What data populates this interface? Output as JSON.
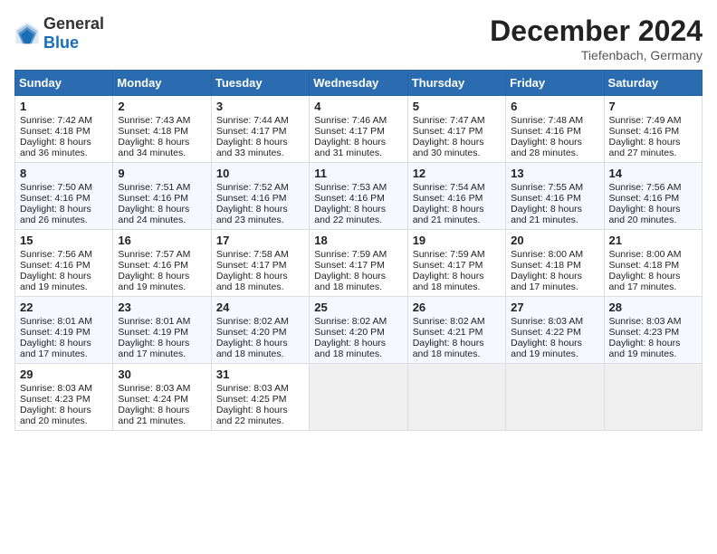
{
  "header": {
    "logo_general": "General",
    "logo_blue": "Blue",
    "month_title": "December 2024",
    "location": "Tiefenbach, Germany"
  },
  "weekdays": [
    "Sunday",
    "Monday",
    "Tuesday",
    "Wednesday",
    "Thursday",
    "Friday",
    "Saturday"
  ],
  "weeks": [
    [
      {
        "day": "1",
        "sunrise": "7:42 AM",
        "sunset": "4:18 PM",
        "daylight": "8 hours and 36 minutes."
      },
      {
        "day": "2",
        "sunrise": "7:43 AM",
        "sunset": "4:18 PM",
        "daylight": "8 hours and 34 minutes."
      },
      {
        "day": "3",
        "sunrise": "7:44 AM",
        "sunset": "4:17 PM",
        "daylight": "8 hours and 33 minutes."
      },
      {
        "day": "4",
        "sunrise": "7:46 AM",
        "sunset": "4:17 PM",
        "daylight": "8 hours and 31 minutes."
      },
      {
        "day": "5",
        "sunrise": "7:47 AM",
        "sunset": "4:17 PM",
        "daylight": "8 hours and 30 minutes."
      },
      {
        "day": "6",
        "sunrise": "7:48 AM",
        "sunset": "4:16 PM",
        "daylight": "8 hours and 28 minutes."
      },
      {
        "day": "7",
        "sunrise": "7:49 AM",
        "sunset": "4:16 PM",
        "daylight": "8 hours and 27 minutes."
      }
    ],
    [
      {
        "day": "8",
        "sunrise": "7:50 AM",
        "sunset": "4:16 PM",
        "daylight": "8 hours and 26 minutes."
      },
      {
        "day": "9",
        "sunrise": "7:51 AM",
        "sunset": "4:16 PM",
        "daylight": "8 hours and 24 minutes."
      },
      {
        "day": "10",
        "sunrise": "7:52 AM",
        "sunset": "4:16 PM",
        "daylight": "8 hours and 23 minutes."
      },
      {
        "day": "11",
        "sunrise": "7:53 AM",
        "sunset": "4:16 PM",
        "daylight": "8 hours and 22 minutes."
      },
      {
        "day": "12",
        "sunrise": "7:54 AM",
        "sunset": "4:16 PM",
        "daylight": "8 hours and 21 minutes."
      },
      {
        "day": "13",
        "sunrise": "7:55 AM",
        "sunset": "4:16 PM",
        "daylight": "8 hours and 21 minutes."
      },
      {
        "day": "14",
        "sunrise": "7:56 AM",
        "sunset": "4:16 PM",
        "daylight": "8 hours and 20 minutes."
      }
    ],
    [
      {
        "day": "15",
        "sunrise": "7:56 AM",
        "sunset": "4:16 PM",
        "daylight": "8 hours and 19 minutes."
      },
      {
        "day": "16",
        "sunrise": "7:57 AM",
        "sunset": "4:16 PM",
        "daylight": "8 hours and 19 minutes."
      },
      {
        "day": "17",
        "sunrise": "7:58 AM",
        "sunset": "4:17 PM",
        "daylight": "8 hours and 18 minutes."
      },
      {
        "day": "18",
        "sunrise": "7:59 AM",
        "sunset": "4:17 PM",
        "daylight": "8 hours and 18 minutes."
      },
      {
        "day": "19",
        "sunrise": "7:59 AM",
        "sunset": "4:17 PM",
        "daylight": "8 hours and 18 minutes."
      },
      {
        "day": "20",
        "sunrise": "8:00 AM",
        "sunset": "4:18 PM",
        "daylight": "8 hours and 17 minutes."
      },
      {
        "day": "21",
        "sunrise": "8:00 AM",
        "sunset": "4:18 PM",
        "daylight": "8 hours and 17 minutes."
      }
    ],
    [
      {
        "day": "22",
        "sunrise": "8:01 AM",
        "sunset": "4:19 PM",
        "daylight": "8 hours and 17 minutes."
      },
      {
        "day": "23",
        "sunrise": "8:01 AM",
        "sunset": "4:19 PM",
        "daylight": "8 hours and 17 minutes."
      },
      {
        "day": "24",
        "sunrise": "8:02 AM",
        "sunset": "4:20 PM",
        "daylight": "8 hours and 18 minutes."
      },
      {
        "day": "25",
        "sunrise": "8:02 AM",
        "sunset": "4:20 PM",
        "daylight": "8 hours and 18 minutes."
      },
      {
        "day": "26",
        "sunrise": "8:02 AM",
        "sunset": "4:21 PM",
        "daylight": "8 hours and 18 minutes."
      },
      {
        "day": "27",
        "sunrise": "8:03 AM",
        "sunset": "4:22 PM",
        "daylight": "8 hours and 19 minutes."
      },
      {
        "day": "28",
        "sunrise": "8:03 AM",
        "sunset": "4:23 PM",
        "daylight": "8 hours and 19 minutes."
      }
    ],
    [
      {
        "day": "29",
        "sunrise": "8:03 AM",
        "sunset": "4:23 PM",
        "daylight": "8 hours and 20 minutes."
      },
      {
        "day": "30",
        "sunrise": "8:03 AM",
        "sunset": "4:24 PM",
        "daylight": "8 hours and 21 minutes."
      },
      {
        "day": "31",
        "sunrise": "8:03 AM",
        "sunset": "4:25 PM",
        "daylight": "8 hours and 22 minutes."
      },
      null,
      null,
      null,
      null
    ]
  ],
  "labels": {
    "sunrise": "Sunrise:",
    "sunset": "Sunset:",
    "daylight": "Daylight:"
  }
}
